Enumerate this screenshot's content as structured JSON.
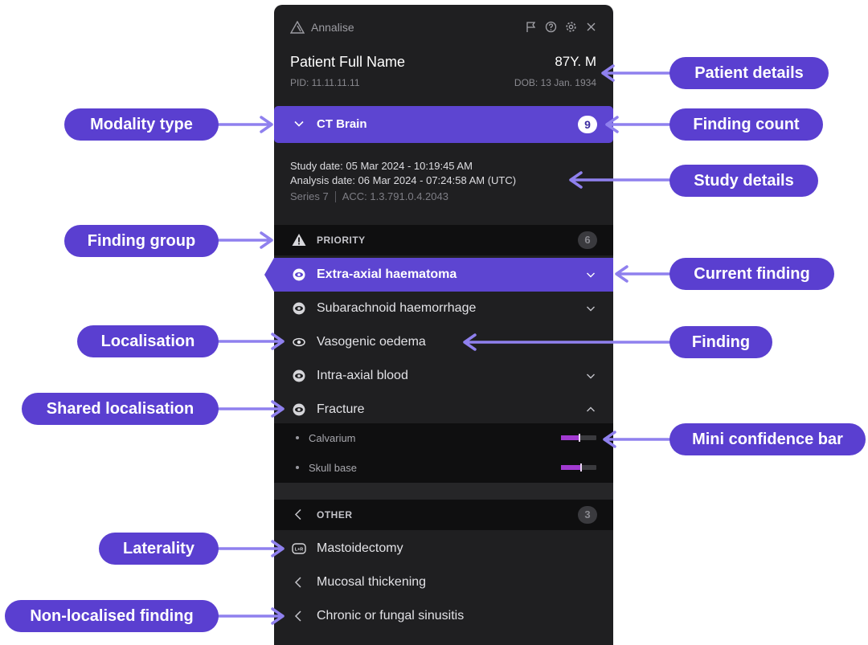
{
  "app": {
    "name": "Annalise"
  },
  "patient": {
    "name": "Patient Full Name",
    "age_sex": "87Y. M",
    "pid": "PID: 11.11.11.11",
    "dob": "DOB: 13 Jan. 1934"
  },
  "modality": {
    "label": "CT Brain",
    "count": "9"
  },
  "study": {
    "study_date": "Study date: 05 Mar 2024 - 10:19:45 AM",
    "analysis_date": "Analysis date: 06 Mar 2024 - 07:24:58 AM (UTC)",
    "series": "Series 7",
    "acc": "ACC: 1.3.791.0.4.2043"
  },
  "groups": {
    "priority": {
      "label": "PRIORITY",
      "count": "6",
      "findings": [
        {
          "label": "Extra-axial haematoma",
          "icon": "eye-icon",
          "current": true
        },
        {
          "label": "Subarachnoid haemorrhage",
          "icon": "eye-icon"
        },
        {
          "label": "Vasogenic oedema",
          "icon": "eye-icon"
        },
        {
          "label": "Intra-axial blood",
          "icon": "eye-icon"
        },
        {
          "label": "Fracture",
          "icon": "shared-eye-icon"
        }
      ],
      "sub_findings": [
        {
          "label": "Calvarium",
          "confidence": 0.5
        },
        {
          "label": "Skull base",
          "confidence": 0.55
        }
      ]
    },
    "other": {
      "label": "OTHER",
      "count": "3",
      "findings": [
        {
          "label": "Mastoidectomy",
          "icon": "laterality-icon"
        },
        {
          "label": "Mucosal thickening",
          "icon": "chevron-left-icon"
        },
        {
          "label": "Chronic or fungal sinusitis",
          "icon": "chevron-left-icon"
        }
      ]
    }
  },
  "callouts": {
    "patient_details": "Patient details",
    "modality_type": "Modality type",
    "finding_count": "Finding count",
    "study_details": "Study details",
    "finding_group": "Finding group",
    "current_finding": "Current finding",
    "localisation": "Localisation",
    "finding": "Finding",
    "shared_localisation": "Shared localisation",
    "mini_confidence_bar": "Mini confidence bar",
    "laterality": "Laterality",
    "non_localised_finding": "Non-localised finding"
  },
  "colors": {
    "accent": "#5d45d1",
    "callout": "#5a3fd0",
    "panel_bg": "#1f1f21",
    "confidence": "#a23ad1",
    "arrow": "#8f80ee"
  }
}
